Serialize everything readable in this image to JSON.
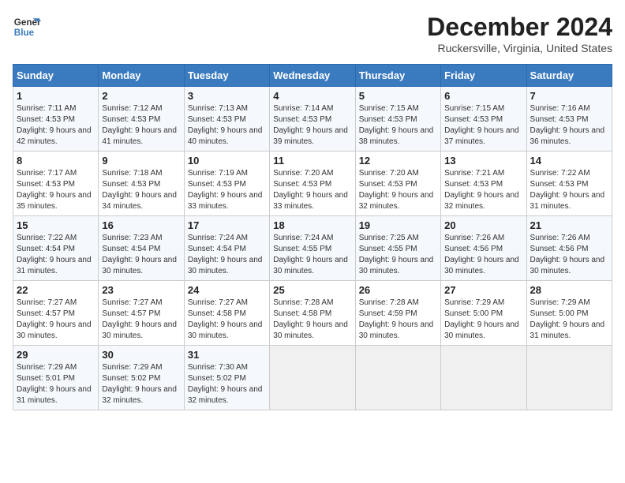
{
  "logo": {
    "line1": "General",
    "line2": "Blue"
  },
  "title": "December 2024",
  "location": "Ruckersville, Virginia, United States",
  "days_of_week": [
    "Sunday",
    "Monday",
    "Tuesday",
    "Wednesday",
    "Thursday",
    "Friday",
    "Saturday"
  ],
  "weeks": [
    [
      {
        "day": "1",
        "sunrise": "7:11 AM",
        "sunset": "4:53 PM",
        "daylight": "9 hours and 42 minutes."
      },
      {
        "day": "2",
        "sunrise": "7:12 AM",
        "sunset": "4:53 PM",
        "daylight": "9 hours and 41 minutes."
      },
      {
        "day": "3",
        "sunrise": "7:13 AM",
        "sunset": "4:53 PM",
        "daylight": "9 hours and 40 minutes."
      },
      {
        "day": "4",
        "sunrise": "7:14 AM",
        "sunset": "4:53 PM",
        "daylight": "9 hours and 39 minutes."
      },
      {
        "day": "5",
        "sunrise": "7:15 AM",
        "sunset": "4:53 PM",
        "daylight": "9 hours and 38 minutes."
      },
      {
        "day": "6",
        "sunrise": "7:15 AM",
        "sunset": "4:53 PM",
        "daylight": "9 hours and 37 minutes."
      },
      {
        "day": "7",
        "sunrise": "7:16 AM",
        "sunset": "4:53 PM",
        "daylight": "9 hours and 36 minutes."
      }
    ],
    [
      {
        "day": "8",
        "sunrise": "7:17 AM",
        "sunset": "4:53 PM",
        "daylight": "9 hours and 35 minutes."
      },
      {
        "day": "9",
        "sunrise": "7:18 AM",
        "sunset": "4:53 PM",
        "daylight": "9 hours and 34 minutes."
      },
      {
        "day": "10",
        "sunrise": "7:19 AM",
        "sunset": "4:53 PM",
        "daylight": "9 hours and 33 minutes."
      },
      {
        "day": "11",
        "sunrise": "7:20 AM",
        "sunset": "4:53 PM",
        "daylight": "9 hours and 33 minutes."
      },
      {
        "day": "12",
        "sunrise": "7:20 AM",
        "sunset": "4:53 PM",
        "daylight": "9 hours and 32 minutes."
      },
      {
        "day": "13",
        "sunrise": "7:21 AM",
        "sunset": "4:53 PM",
        "daylight": "9 hours and 32 minutes."
      },
      {
        "day": "14",
        "sunrise": "7:22 AM",
        "sunset": "4:53 PM",
        "daylight": "9 hours and 31 minutes."
      }
    ],
    [
      {
        "day": "15",
        "sunrise": "7:22 AM",
        "sunset": "4:54 PM",
        "daylight": "9 hours and 31 minutes."
      },
      {
        "day": "16",
        "sunrise": "7:23 AM",
        "sunset": "4:54 PM",
        "daylight": "9 hours and 30 minutes."
      },
      {
        "day": "17",
        "sunrise": "7:24 AM",
        "sunset": "4:54 PM",
        "daylight": "9 hours and 30 minutes."
      },
      {
        "day": "18",
        "sunrise": "7:24 AM",
        "sunset": "4:55 PM",
        "daylight": "9 hours and 30 minutes."
      },
      {
        "day": "19",
        "sunrise": "7:25 AM",
        "sunset": "4:55 PM",
        "daylight": "9 hours and 30 minutes."
      },
      {
        "day": "20",
        "sunrise": "7:26 AM",
        "sunset": "4:56 PM",
        "daylight": "9 hours and 30 minutes."
      },
      {
        "day": "21",
        "sunrise": "7:26 AM",
        "sunset": "4:56 PM",
        "daylight": "9 hours and 30 minutes."
      }
    ],
    [
      {
        "day": "22",
        "sunrise": "7:27 AM",
        "sunset": "4:57 PM",
        "daylight": "9 hours and 30 minutes."
      },
      {
        "day": "23",
        "sunrise": "7:27 AM",
        "sunset": "4:57 PM",
        "daylight": "9 hours and 30 minutes."
      },
      {
        "day": "24",
        "sunrise": "7:27 AM",
        "sunset": "4:58 PM",
        "daylight": "9 hours and 30 minutes."
      },
      {
        "day": "25",
        "sunrise": "7:28 AM",
        "sunset": "4:58 PM",
        "daylight": "9 hours and 30 minutes."
      },
      {
        "day": "26",
        "sunrise": "7:28 AM",
        "sunset": "4:59 PM",
        "daylight": "9 hours and 30 minutes."
      },
      {
        "day": "27",
        "sunrise": "7:29 AM",
        "sunset": "5:00 PM",
        "daylight": "9 hours and 30 minutes."
      },
      {
        "day": "28",
        "sunrise": "7:29 AM",
        "sunset": "5:00 PM",
        "daylight": "9 hours and 31 minutes."
      }
    ],
    [
      {
        "day": "29",
        "sunrise": "7:29 AM",
        "sunset": "5:01 PM",
        "daylight": "9 hours and 31 minutes."
      },
      {
        "day": "30",
        "sunrise": "7:29 AM",
        "sunset": "5:02 PM",
        "daylight": "9 hours and 32 minutes."
      },
      {
        "day": "31",
        "sunrise": "7:30 AM",
        "sunset": "5:02 PM",
        "daylight": "9 hours and 32 minutes."
      },
      null,
      null,
      null,
      null
    ]
  ]
}
